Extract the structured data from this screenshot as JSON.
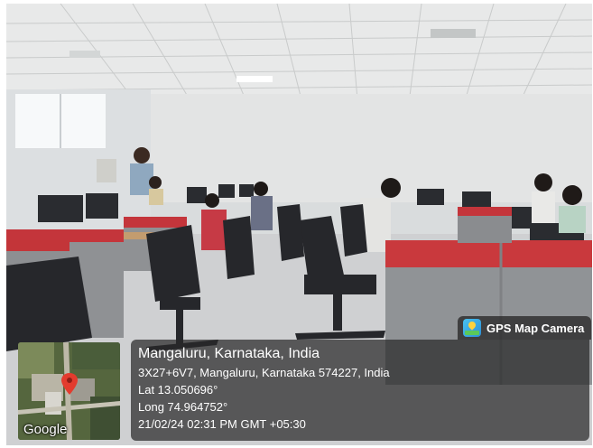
{
  "overlay": {
    "app_name": "GPS Map Camera",
    "location_title": "Mangaluru, Karnataka, India",
    "address": "3X27+6V7, Mangaluru, Karnataka 574227, India",
    "latitude": "Lat 13.050696°",
    "longitude": "Long 74.964752°",
    "datetime": "21/02/24 02:31 PM GMT +05:30",
    "map_provider": "Google"
  },
  "colors": {
    "overlay_bg": "#282828",
    "partition_red": "#c8383c",
    "partition_grey": "#8f9093",
    "ceiling": "#e6e7e7",
    "map_pin": "#e33b2e"
  },
  "icons": {
    "app_logo": "gps-map-camera-logo-icon",
    "map_pin": "map-pin-icon"
  }
}
